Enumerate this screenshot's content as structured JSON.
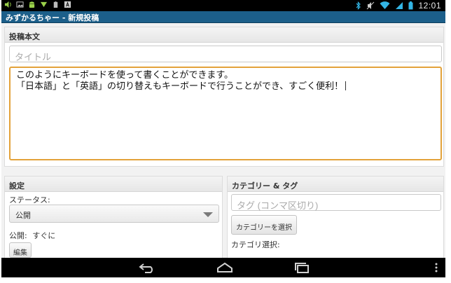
{
  "status_bar": {
    "time": "12:01"
  },
  "app_bar": {
    "title": "みずかるちゃー - 新規投稿"
  },
  "post": {
    "header": "投稿本文",
    "title_placeholder": "タイトル",
    "body_lines": [
      "このようにキーボードを使って書くことができます。",
      "「日本語」と「英語」の切り替えもキーボードで行うことができ、すごく便利！"
    ]
  },
  "settings": {
    "header": "設定",
    "status_label": "ステータス:",
    "status_value": "公開",
    "publish_label": "公開:",
    "publish_value": "すぐに",
    "edit_button": "編集"
  },
  "category": {
    "header": "カテゴリー & タグ",
    "tag_placeholder": "タグ (コンマ区切り)",
    "select_button": "カテゴリーを選択",
    "selection_label": "カテゴリ選択:"
  },
  "colors": {
    "app_bar": "#1c5f8a",
    "focus_border": "#e3a23a",
    "status_icon": "#33b5e5"
  },
  "icons": [
    "volume-icon",
    "image-icon",
    "android-icon",
    "download-icon",
    "battery-small-icon",
    "text-a-icon",
    "bluetooth-icon",
    "mute-icon",
    "wifi-icon",
    "signal-icon",
    "battery-icon",
    "back-icon",
    "home-icon",
    "recent-apps-icon",
    "overflow-menu-icon"
  ]
}
